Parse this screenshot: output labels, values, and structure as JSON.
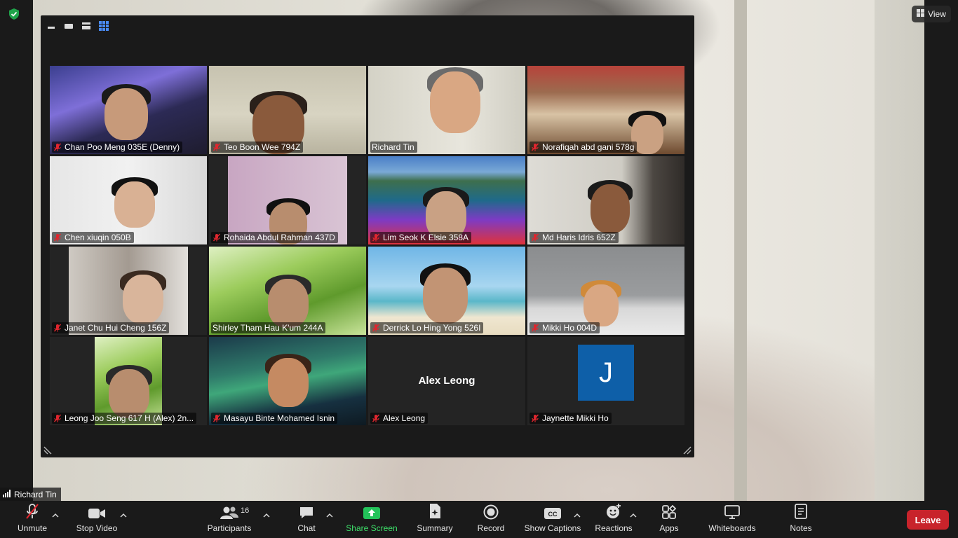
{
  "active_speaker": {
    "name": "Richard Tin"
  },
  "view_button": {
    "label": "View"
  },
  "participants": [
    {
      "name": "Chan Poo Meng 035E (Denny)",
      "muted": true,
      "scene": "night-ship"
    },
    {
      "name": "Teo Boon Wee 794Z",
      "muted": true,
      "scene": "room"
    },
    {
      "name": "Richard Tin",
      "muted": false,
      "scene": "room-light",
      "active": true
    },
    {
      "name": "Norafiqah abd gani 578g",
      "muted": true,
      "scene": "living-room"
    },
    {
      "name": "Chen xiuqin 050B",
      "muted": true,
      "scene": "white-wall"
    },
    {
      "name": "Rohaida Abdul Rahman 437D",
      "muted": true,
      "scene": "pink-room"
    },
    {
      "name": "Lim Seok K Elsie 358A",
      "muted": true,
      "scene": "lake-flowers"
    },
    {
      "name": "Md Haris Idris 652Z",
      "muted": true,
      "scene": "window"
    },
    {
      "name": "Janet Chu Hui Cheng 156Z",
      "muted": true,
      "scene": "office"
    },
    {
      "name": "Shirley Tham Hau K'um 244A",
      "muted": false,
      "scene": "grass"
    },
    {
      "name": "Derrick Lo Hing Yong 526I",
      "muted": true,
      "scene": "beach"
    },
    {
      "name": "Mikki Ho 004D",
      "muted": true,
      "scene": "desk-plants"
    },
    {
      "name": "Leong Joo Seng 617 H (Alex) 2n...",
      "muted": true,
      "scene": "grass"
    },
    {
      "name": "Masayu Binte Mohamed Isnin",
      "muted": true,
      "scene": "aurora-avatar"
    },
    {
      "name": "Alex Leong",
      "muted": true,
      "scene": "no-video",
      "display_text": "Alex Leong"
    },
    {
      "name": "Jaynette Mikki Ho",
      "muted": true,
      "scene": "initial",
      "initial": "J"
    }
  ],
  "toolbar": {
    "unmute": "Unmute",
    "stop_video": "Stop Video",
    "participants": "Participants",
    "participants_count": "16",
    "chat": "Chat",
    "share_screen": "Share Screen",
    "summary": "Summary",
    "record": "Record",
    "show_captions": "Show Captions",
    "reactions": "Reactions",
    "apps": "Apps",
    "whiteboards": "Whiteboards",
    "notes": "Notes",
    "leave": "Leave"
  },
  "colors": {
    "accent_green": "#3ee06a",
    "leave_red": "#c8232b",
    "active_outline": "#e8f07a",
    "muted_red": "#e0262e",
    "avatar_blue": "#0e5fa8"
  }
}
